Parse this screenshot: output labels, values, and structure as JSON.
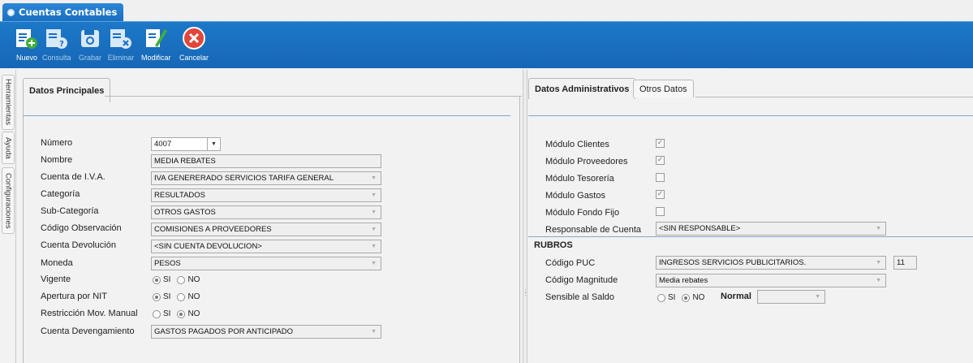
{
  "window": {
    "title": "Cuentas Contables"
  },
  "toolbar": {
    "nuevo": "Nuevo",
    "consulta": "Consulta",
    "grabar": "Grabar",
    "eliminar": "Eliminar",
    "modificar": "Modificar",
    "cancelar": "Cancelar"
  },
  "sidebar": {
    "tabs": [
      "Herramientas",
      "Ayuda",
      "Configuraciones"
    ]
  },
  "left": {
    "tab": "Datos Principales",
    "fields": {
      "numero": {
        "label": "Número",
        "value": "4007"
      },
      "nombre": {
        "label": "Nombre",
        "value": "MEDIA REBATES"
      },
      "iva": {
        "label": "Cuenta de I.V.A.",
        "value": "IVA GENERERADO SERVICIOS TARIFA GENERAL"
      },
      "categoria": {
        "label": "Categoría",
        "value": "RESULTADOS"
      },
      "subcategoria": {
        "label": "Sub-Categoría",
        "value": "OTROS GASTOS"
      },
      "observacion": {
        "label": "Código Observación",
        "value": "COMISIONES A PROVEEDORES"
      },
      "devolucion": {
        "label": "Cuenta Devolución",
        "value": "<SIN CUENTA DEVOLUCION>"
      },
      "moneda": {
        "label": "Moneda",
        "value": "PESOS"
      },
      "vigente": {
        "label": "Vigente",
        "selected": "SI"
      },
      "apertura": {
        "label": "Apertura por NIT",
        "selected": "SI"
      },
      "restriccion": {
        "label": "Restricción Mov. Manual",
        "selected": "NO"
      },
      "devengamiento": {
        "label": "Cuenta Devengamiento",
        "value": "GASTOS PAGADOS POR ANTICIPADO"
      }
    },
    "radio_si": "SI",
    "radio_no": "NO"
  },
  "right": {
    "tabs": [
      "Datos Administrativos",
      "Otros Datos"
    ],
    "modulos": [
      {
        "label": "Módulo Clientes",
        "checked": true
      },
      {
        "label": "Módulo Proveedores",
        "checked": true
      },
      {
        "label": "Módulo Tesorería",
        "checked": false
      },
      {
        "label": "Módulo Gastos",
        "checked": true
      },
      {
        "label": "Módulo Fondo Fijo",
        "checked": false
      }
    ],
    "responsable": {
      "label": "Responsable de Cuenta",
      "value": "<SIN RESPONSABLE>"
    },
    "rubros": {
      "heading": "RUBROS",
      "puc": {
        "label": "Código PUC",
        "value": "INGRESOS SERVICIOS PUBLICITARIOS.",
        "code": "11"
      },
      "magnitude": {
        "label": "Código Magnitude",
        "value": "Media rebates"
      },
      "sensible": {
        "label": "Sensible al Saldo",
        "selected": "NO",
        "normal_label": "Normal",
        "normal_value": ""
      }
    }
  },
  "colors": {
    "toolbar": "#1a6fc0",
    "title_tab": "#1f7bcf",
    "cancel": "#e0463b",
    "icon_green": "#3fae3a"
  }
}
